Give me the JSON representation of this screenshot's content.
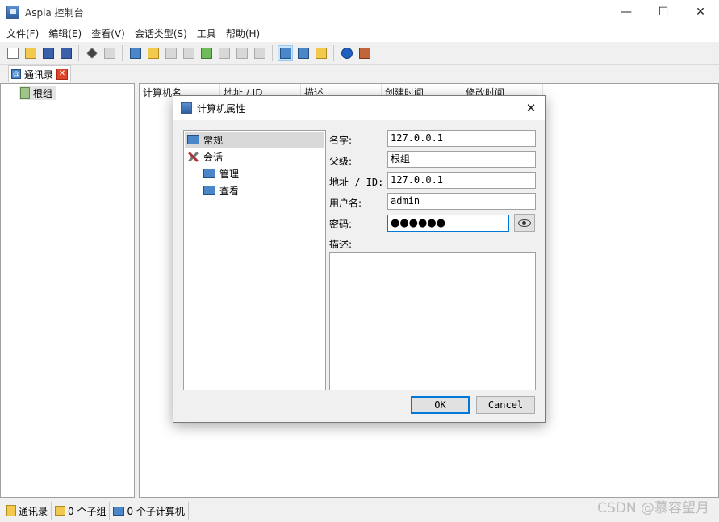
{
  "window": {
    "title": "Aspia 控制台",
    "minimize": "—",
    "maximize": "☐",
    "close": "✕"
  },
  "menu": [
    "文件(F)",
    "编辑(E)",
    "查看(V)",
    "会话类型(S)",
    "工具",
    "帮助(H)"
  ],
  "tab": {
    "label": "通讯录",
    "icon": "@",
    "close": "✕"
  },
  "tree": {
    "root": "根组"
  },
  "table": {
    "columns": [
      "计算机名",
      "地址 / ID",
      "描述",
      "创建时间",
      "修改时间"
    ]
  },
  "status": {
    "book": "通讯录",
    "groups": "0 个子组",
    "computers": "0 个子计算机"
  },
  "watermark": "CSDN @慕容望月",
  "dialog": {
    "title": "计算机属性",
    "close": "✕",
    "tree": [
      "常规",
      "会话",
      "管理",
      "查看"
    ],
    "fields": {
      "name_label": "名字:",
      "name_value": "127.0.0.1",
      "parent_label": "父级:",
      "parent_value": "根组",
      "address_label": "地址 / ID:",
      "address_value": "127.0.0.1",
      "user_label": "用户名:",
      "user_value": "admin",
      "password_label": "密码:",
      "password_value": "●●●●●●",
      "desc_label": "描述:",
      "desc_value": ""
    },
    "ok": "OK",
    "cancel": "Cancel"
  }
}
